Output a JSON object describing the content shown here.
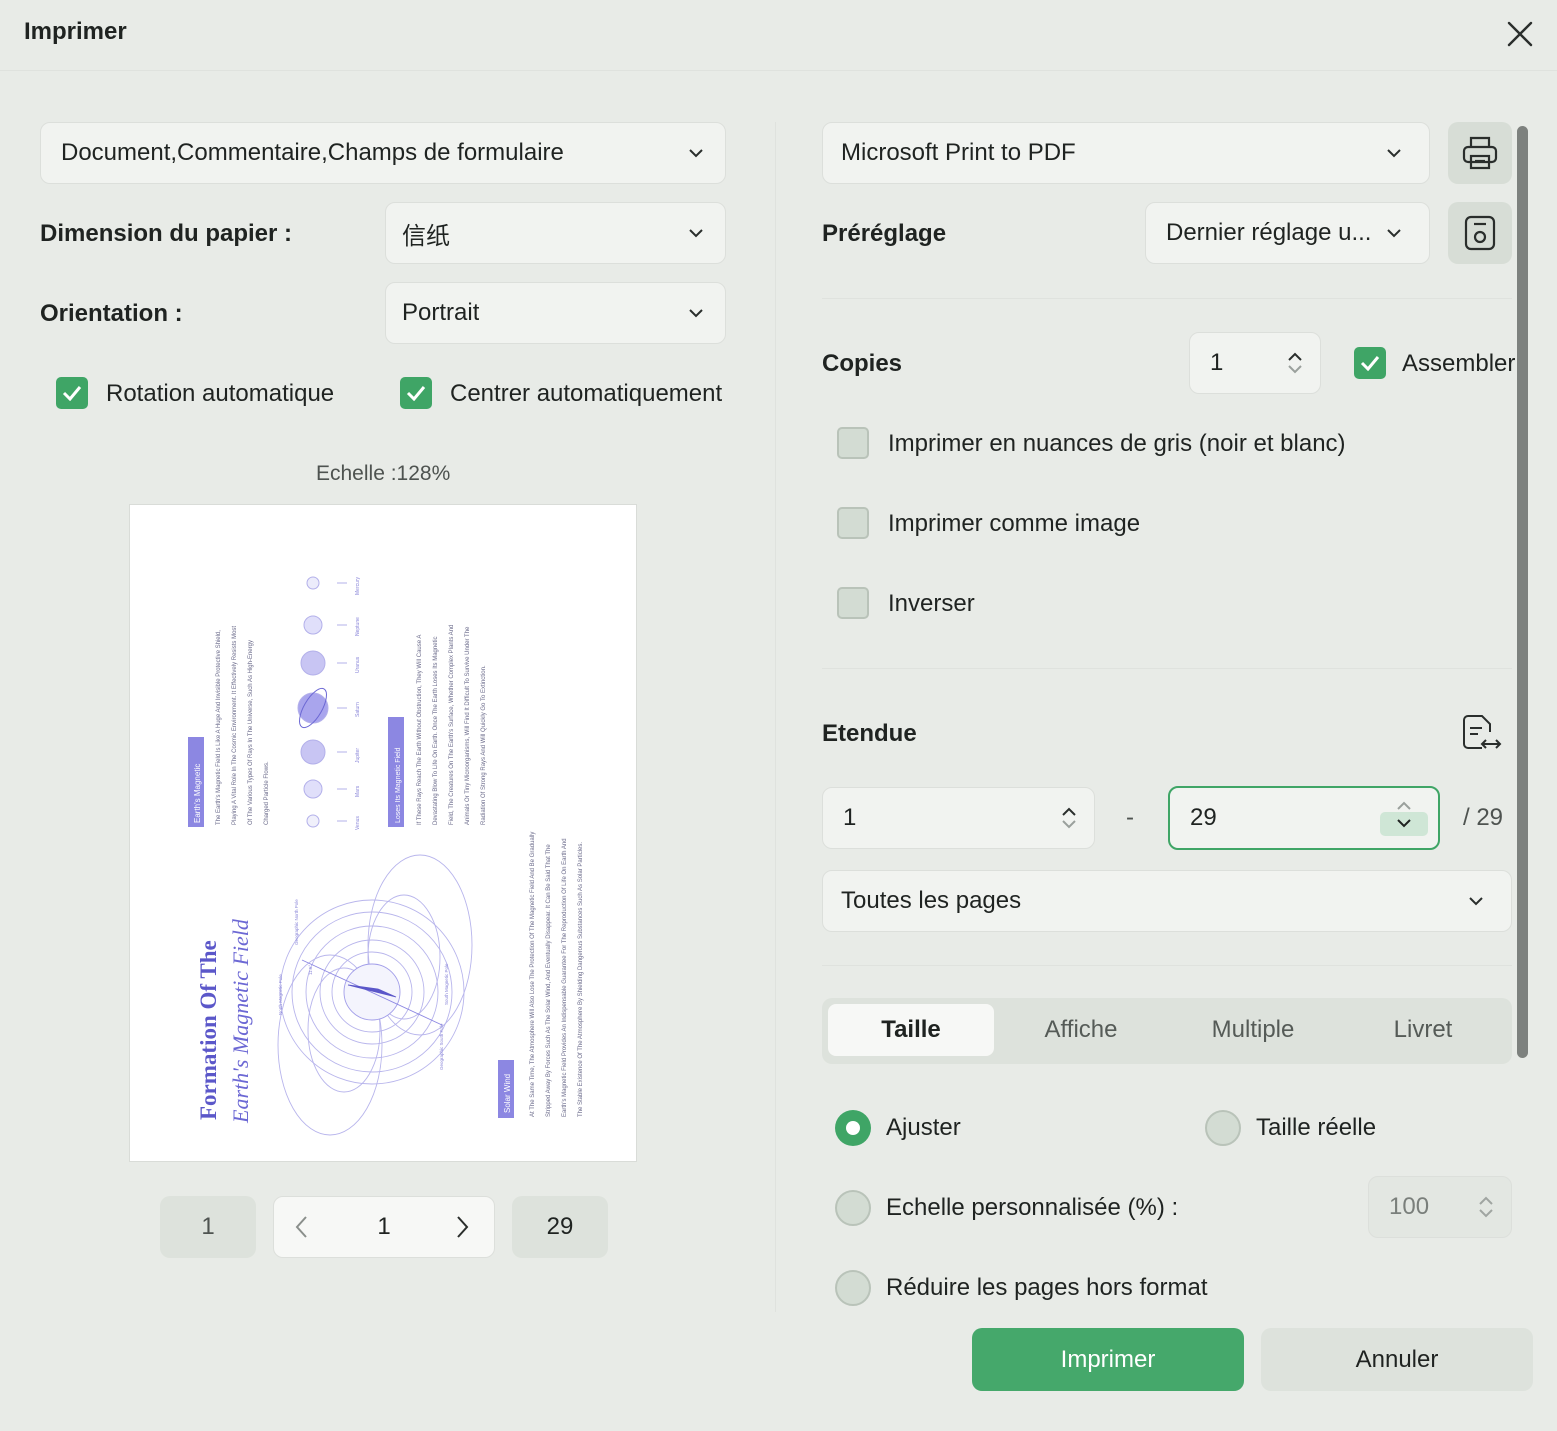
{
  "window": {
    "title": "Imprimer"
  },
  "left": {
    "content_select": "Document,Commentaire,Champs de formulaire",
    "paper_size": {
      "label": "Dimension du papier :",
      "value": "信纸"
    },
    "orientation": {
      "label": "Orientation :",
      "value": "Portrait"
    },
    "auto_rotate": {
      "label": "Rotation automatique",
      "checked": true
    },
    "auto_center": {
      "label": "Centrer automatiquement",
      "checked": true
    },
    "scale_text": "Echelle :128%",
    "preview": {
      "title_line1": "Formation Of The",
      "title_line2": "Earth's Magnetic Field",
      "tag1": "Earth's Magnetic",
      "tag2": "Loses Its Magnetic Field",
      "tag3": "Solar Wind",
      "planets": [
        "Mercury",
        "Neptune",
        "Uranus",
        "Saturn",
        "Jupiter",
        "Mars",
        "Venus"
      ],
      "para1": [
        "The Earth's Magnetic Field Is Like A Huge And Invisible Protective Shield,",
        "Playing A Vital Role In The Cosmic Environment. It Effectively Resists Most",
        "Of The Various Types Of Rays In The Universe, Such As High-Energy",
        "Charged Particle Flows."
      ],
      "para2": [
        "If These Rays Reach The Earth Without Obstruction, They Will Cause A",
        "Devastating Blow To Life On Earth. Once The Earth Loses Its Magnetic",
        "Field, The Creatures On The Earth's Surface, Whether Complex Plants And",
        "Animals Or Tiny Microorganisms, Will Find It Difficult To Survive Under The",
        "Radiation Of Strong Rays And Will Quickly Go To Extinction."
      ],
      "para3": [
        "At The Same Time, The Atmosphere Will Also Lose The Protection Of The Magnetic Field And Be Gradually",
        "Stripped Away By Forces Such As The Solar Wind, And Eventually Disappear. It Can Be Said That The",
        "Earth's Magnetic Field Provides An Indispensable Guarantee For The Reproduction Of Life On Earth And",
        "The Stable Existence Of The Atmosphere By Shielding Dangerous Substances Such As Solar Particles."
      ],
      "labels": {
        "geo_north": "Geographic North Pole",
        "geo_south": "Geographic South Pole",
        "mag_north": "North Magnetic Pole",
        "mag_south": "South Magnetic Pole",
        "angle": "11.5°"
      }
    },
    "pager": {
      "first": "1",
      "current": "1",
      "last": "29"
    }
  },
  "right": {
    "printer": "Microsoft Print to PDF",
    "preset": {
      "label": "Préréglage",
      "value": "Dernier réglage u..."
    },
    "copies": {
      "label": "Copies",
      "value": "1"
    },
    "collate": {
      "label": "Assembler",
      "checked": true
    },
    "grayscale": {
      "label": "Imprimer en nuances de gris (noir et blanc)",
      "checked": false
    },
    "as_image": {
      "label": "Imprimer comme image",
      "checked": false
    },
    "reverse": {
      "label": "Inverser",
      "checked": false
    },
    "range": {
      "label": "Etendue",
      "from": "1",
      "dash": "-",
      "to": "29",
      "total": "/ 29"
    },
    "pages_select": "Toutes les pages",
    "tabs": [
      "Taille",
      "Affiche",
      "Multiple",
      "Livret"
    ],
    "sizing": {
      "fit": "Ajuster",
      "actual": "Taille réelle",
      "custom": "Echelle personnalisée (%) :",
      "custom_value": "100",
      "shrink": "Réduire les pages hors format"
    },
    "print_button": "Imprimer",
    "cancel_button": "Annuler"
  },
  "colors": {
    "accent": "#45a86b",
    "preview_text": "#5b57c9"
  }
}
